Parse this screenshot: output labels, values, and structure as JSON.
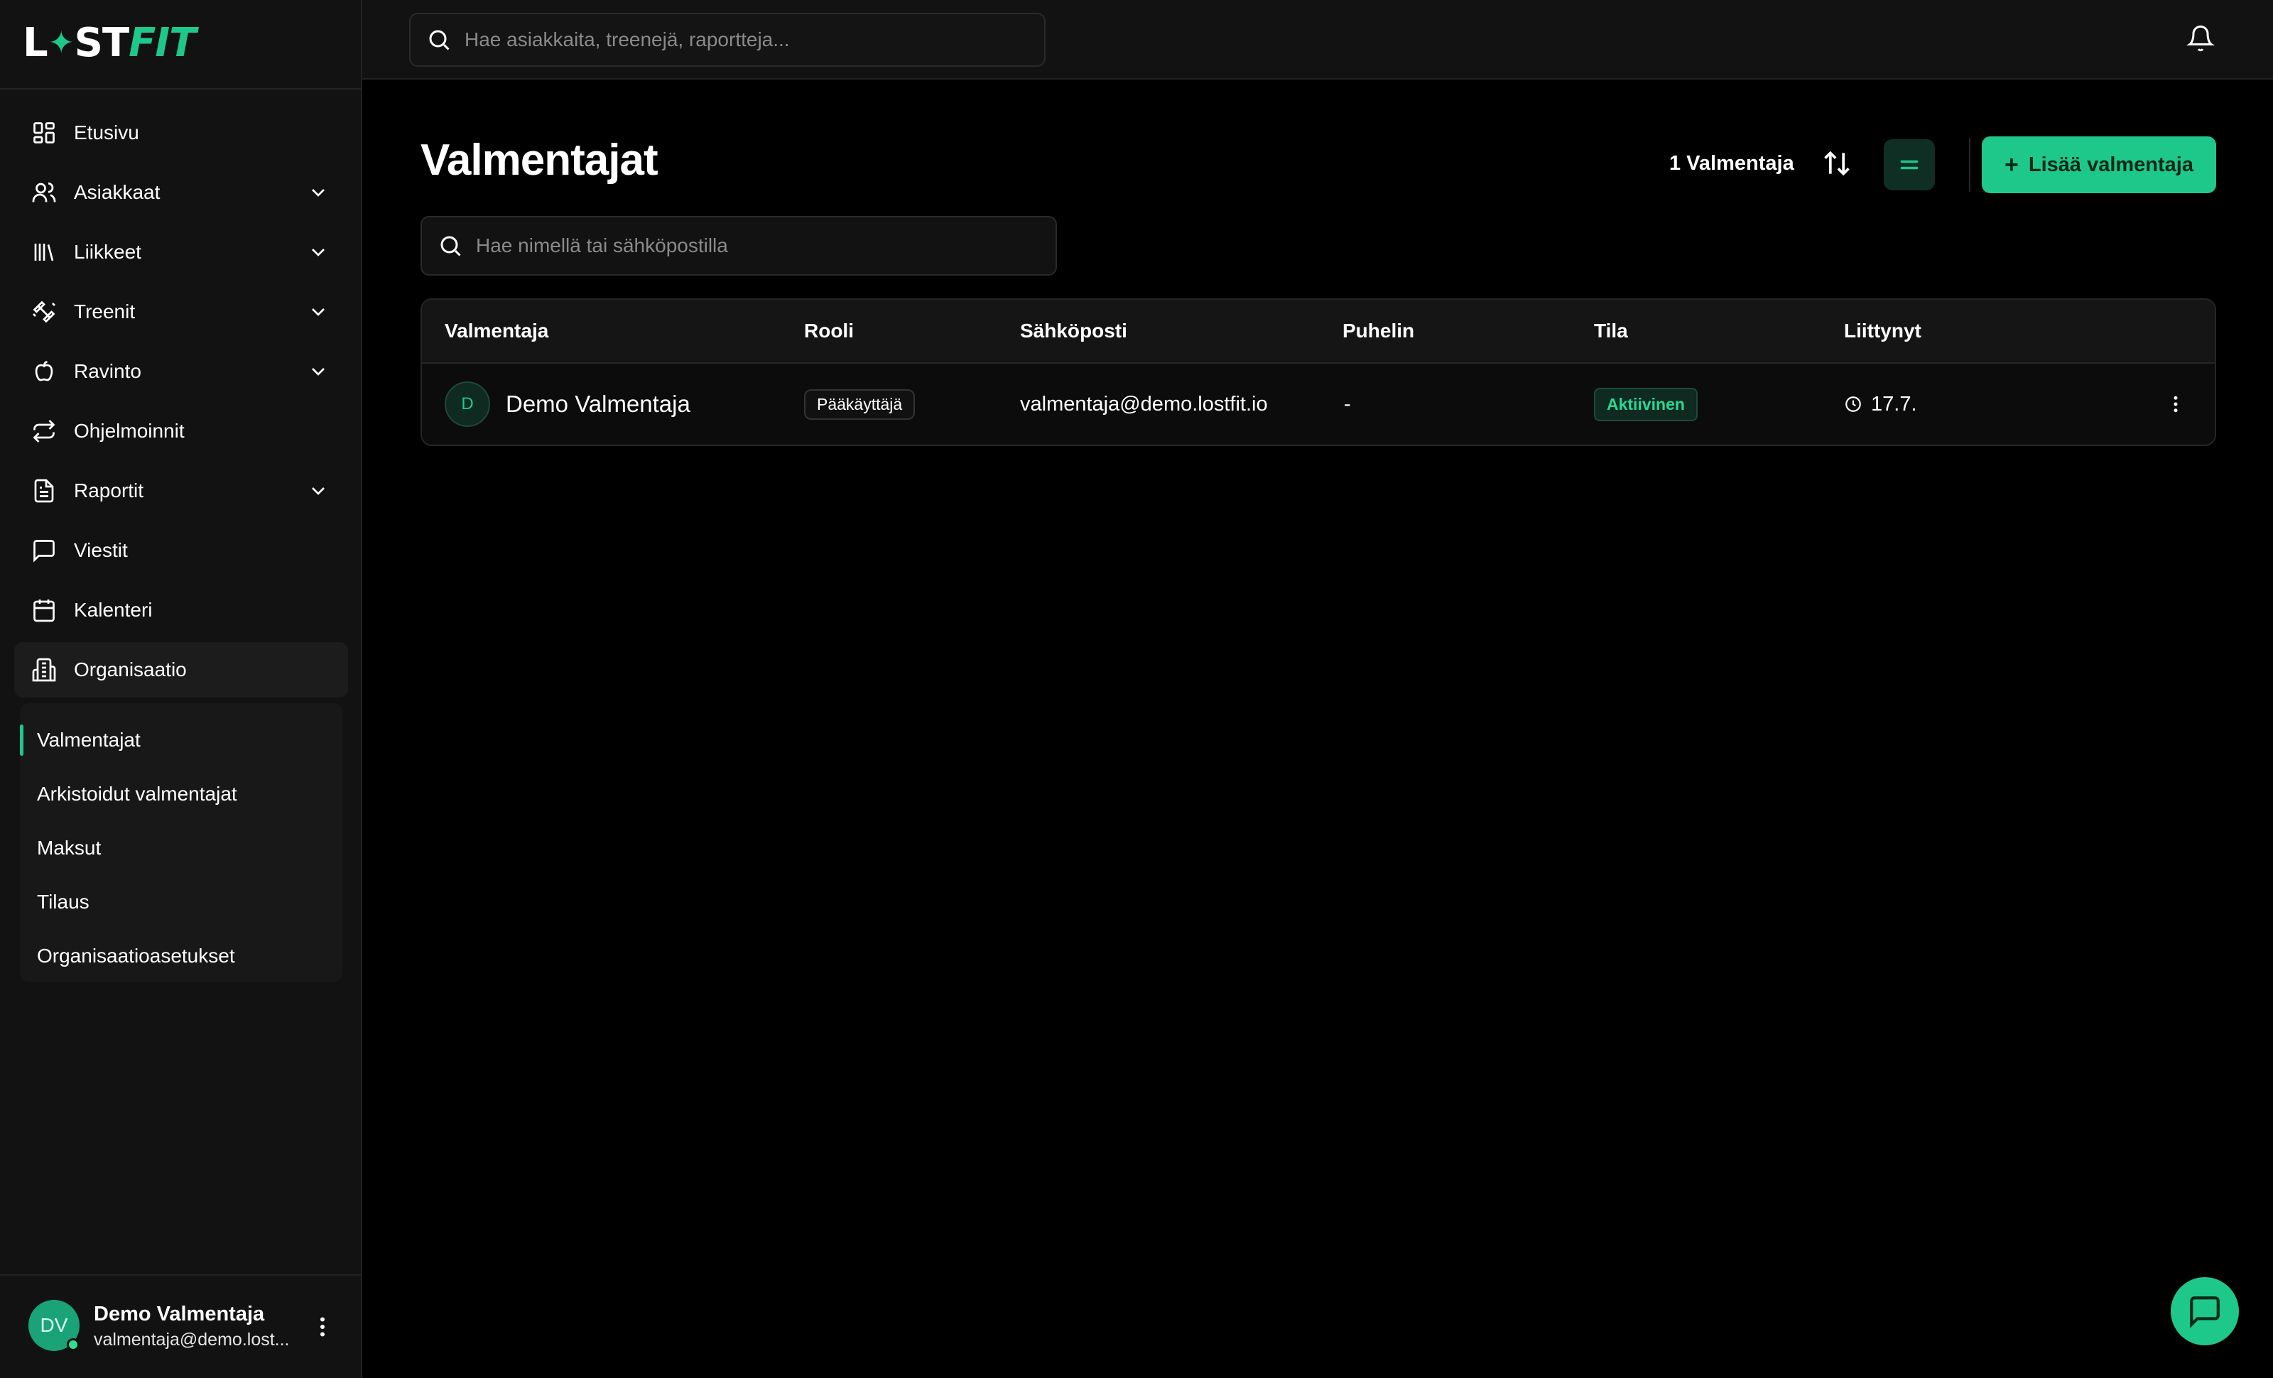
{
  "brand": {
    "logo_left": "L",
    "logo_mid": "ST",
    "logo_right": "FIT",
    "accent": "#1ec88a"
  },
  "sidebar": {
    "items": [
      {
        "label": "Etusivu",
        "icon": "dashboard-icon",
        "expandable": false
      },
      {
        "label": "Asiakkaat",
        "icon": "users-icon",
        "expandable": true
      },
      {
        "label": "Liikkeet",
        "icon": "library-icon",
        "expandable": true
      },
      {
        "label": "Treenit",
        "icon": "dumbbell-icon",
        "expandable": true
      },
      {
        "label": "Ravinto",
        "icon": "apple-icon",
        "expandable": true
      },
      {
        "label": "Ohjelmoinnit",
        "icon": "repeat-icon",
        "expandable": false
      },
      {
        "label": "Raportit",
        "icon": "file-text-icon",
        "expandable": true
      },
      {
        "label": "Viestit",
        "icon": "message-square-icon",
        "expandable": false
      },
      {
        "label": "Kalenteri",
        "icon": "calendar-icon",
        "expandable": false
      },
      {
        "label": "Organisaatio",
        "icon": "building-icon",
        "expandable": false,
        "active": true
      }
    ],
    "subitems": [
      {
        "label": "Valmentajat",
        "active": true
      },
      {
        "label": "Arkistoidut valmentajat"
      },
      {
        "label": "Maksut"
      },
      {
        "label": "Tilaus"
      },
      {
        "label": "Organisaatioasetukset"
      }
    ],
    "user": {
      "initials": "DV",
      "name": "Demo Valmentaja",
      "email": "valmentaja@demo.lost..."
    }
  },
  "topbar": {
    "search_placeholder": "Hae asiakkaita, treenejä, raportteja..."
  },
  "main": {
    "title": "Valmentajat",
    "count": "1 Valmentaja",
    "add_button": "Lisää valmentaja",
    "search_placeholder": "Hae nimellä tai sähköpostilla",
    "columns": [
      "Valmentaja",
      "Rooli",
      "Sähköposti",
      "Puhelin",
      "Tila",
      "Liittynyt"
    ],
    "rows": [
      {
        "initial": "D",
        "name": "Demo Valmentaja",
        "role": "Pääkäyttäjä",
        "email": "valmentaja@demo.lostfit.io",
        "phone": "-",
        "status": "Aktiivinen",
        "joined": "17.7."
      }
    ]
  }
}
